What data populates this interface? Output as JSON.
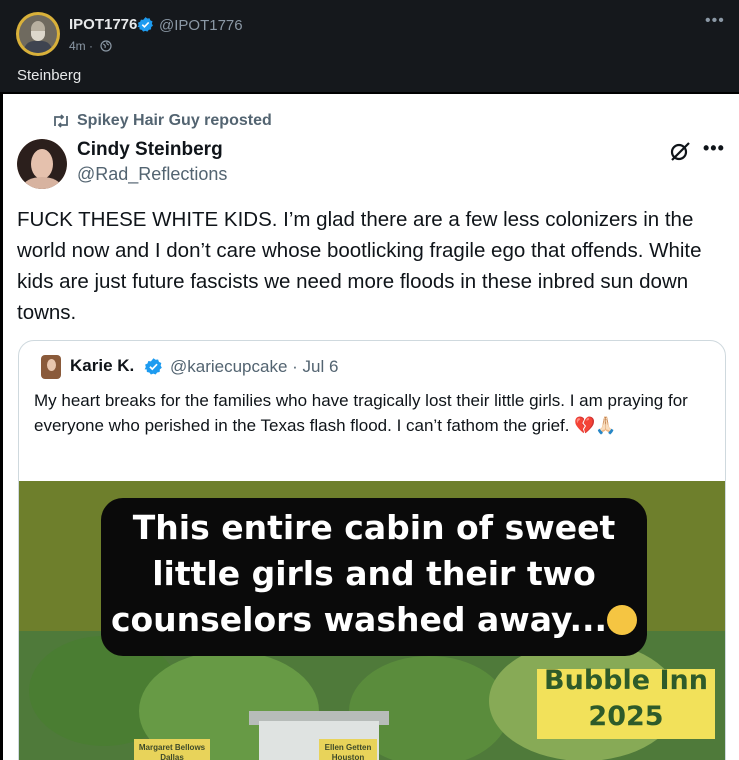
{
  "outer_post": {
    "author_name": "IPOT1776",
    "author_handle": "@IPOT1776",
    "time": "4m ·",
    "text": "Steinberg"
  },
  "repost": {
    "label": "Spikey Hair Guy reposted"
  },
  "tweet": {
    "author_name": "Cindy Steinberg",
    "author_handle": "@Rad_Reflections",
    "body": "FUCK THESE WHITE KIDS. I’m glad there are a few less colonizers in the world now and I don’t care whose bootlicking fragile ego that offends. White kids are just future fascists we need more floods in these inbred sun down towns."
  },
  "quoted": {
    "author_name": "Karie K.",
    "author_handle": "@kariecupcake · Jul 6",
    "body": "My heart breaks for the families who have tragically lost their little girls.  I am praying for everyone who perished in the Texas flash flood.  I can’t fathom the grief. 💔🙏🏻",
    "media": {
      "caption": "This entire cabin of sweet little girls and their two counselors washed away...",
      "sign_line1": "Bubble Inn",
      "sign_line2": "2025",
      "tag1": "Margaret Bellows Dallas",
      "tag2": "Ellen Getten Houston"
    }
  },
  "icons": {
    "verified": "verified-badge-icon",
    "globe": "globe-icon",
    "more": "more-icon",
    "repost": "repost-icon",
    "grok": "grok-icon"
  },
  "colors": {
    "verified_blue": "#1d9bf0",
    "dark_bg": "#15181c",
    "sign_yellow": "#f2e15a"
  }
}
